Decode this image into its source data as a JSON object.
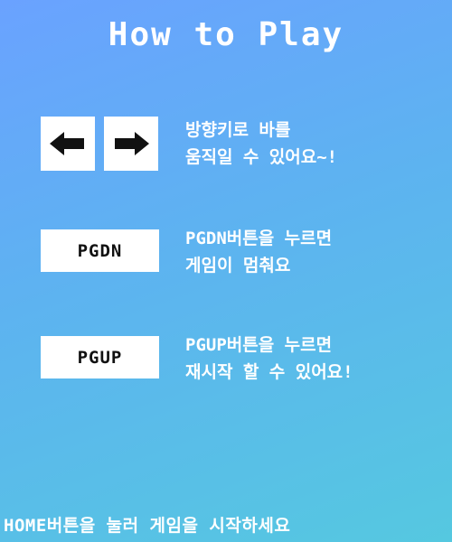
{
  "title": "How to Play",
  "instructions": {
    "arrows": {
      "left_icon": "left-arrow",
      "right_icon": "right-arrow",
      "line1": "방향키로 바를",
      "line2": "움직일 수 있어요~!"
    },
    "pgdn": {
      "key_label": "PGDN",
      "line1": "PGDN버튼을 누르면",
      "line2": "게임이 멈춰요"
    },
    "pgup": {
      "key_label": "PGUP",
      "line1": "PGUP버튼을 누르면",
      "line2": "재시작 할 수 있어요!"
    }
  },
  "footer": "HOME버튼을 눌러 게임을 시작하세요"
}
